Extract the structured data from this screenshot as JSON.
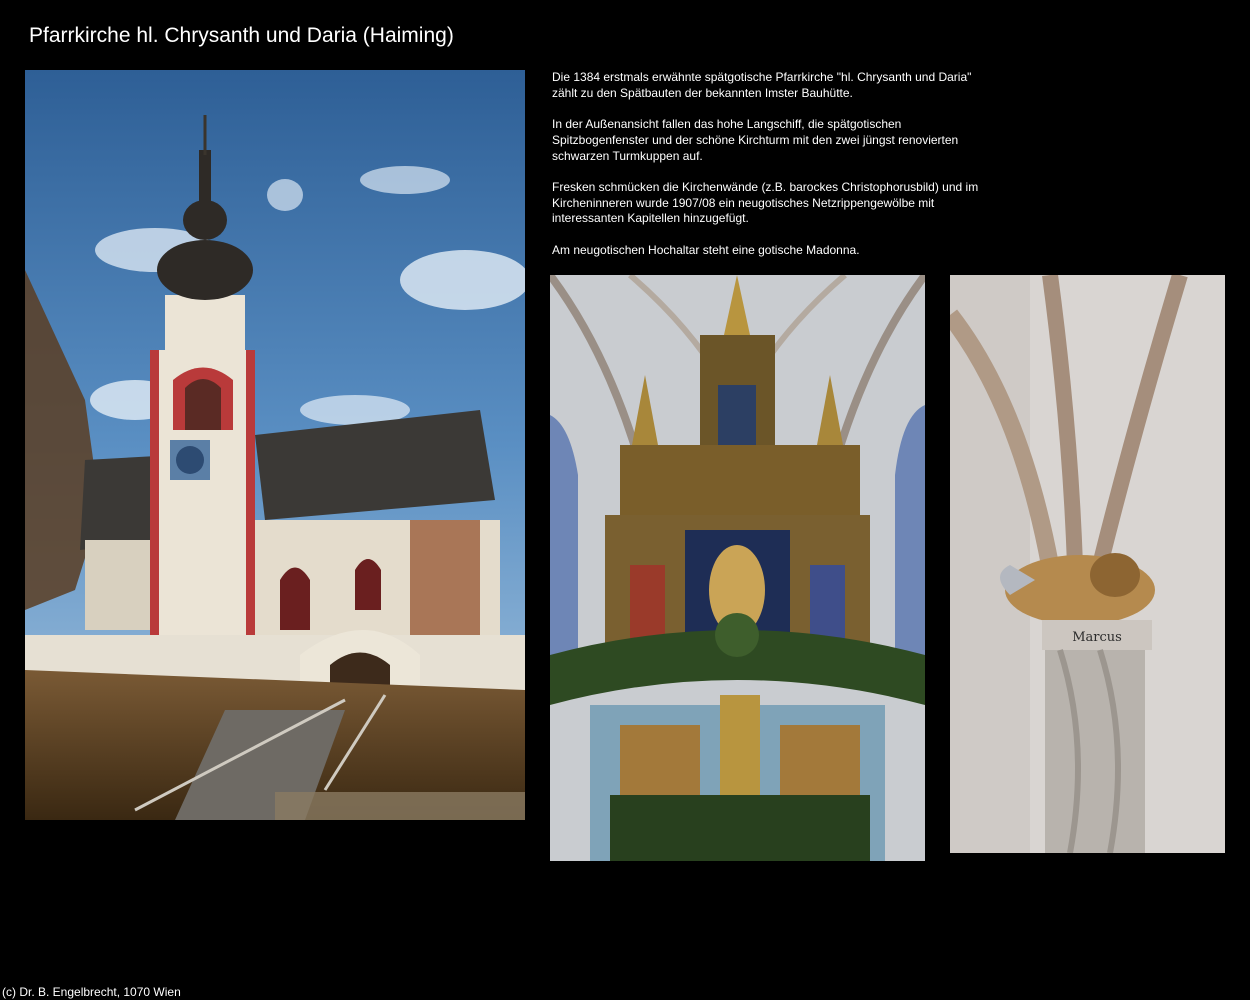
{
  "page": {
    "title": "Pfarrkirche hl. Chrysanth und Daria (Haiming)"
  },
  "description": {
    "paragraphs": [
      "Die 1384 erstmals erwähnte spätgotische Pfarrkirche \"hl. Chrysanth und Daria\" zählt zu den Spätbauten der bekannten Imster Bauhütte.",
      "In der Außenansicht fallen das hohe Langschiff, die spätgotischen Spitzbogenfenster und der schöne Kirchturm mit den zwei jüngst renovierten schwarzen Turmkuppen auf.",
      "Fresken schmücken die Kirchenwände (z.B. barockes Christophorusbild) und im Kircheninneren wurde 1907/08 ein neugotisches Netzrippengewölbe mit interessanten Kapitellen hinzugefügt.",
      "Am neugotischen Hochaltar steht eine gotische Madonna."
    ]
  },
  "photos": {
    "capital_inscription": "Marcus"
  },
  "footer": {
    "copyright": "(c) Dr. B. Engelbrecht, 1070 Wien"
  }
}
